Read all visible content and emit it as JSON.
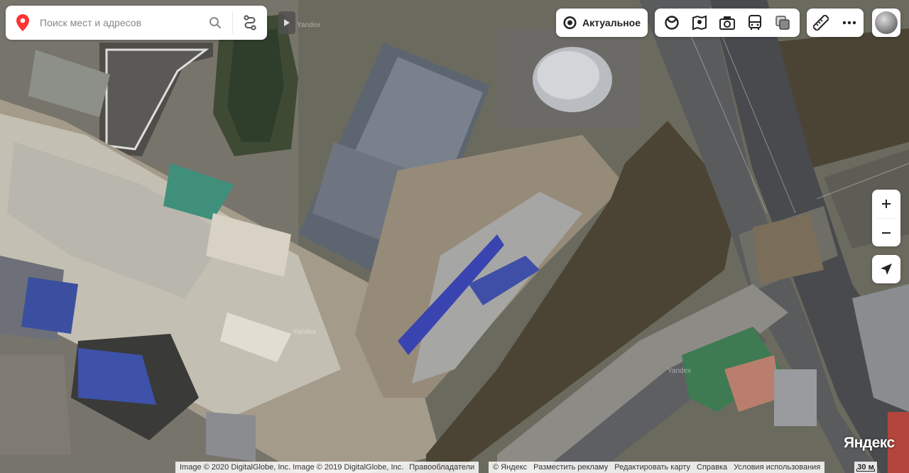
{
  "search": {
    "placeholder": "Поиск мест и адресов"
  },
  "layer_button": {
    "label": "Актуальное"
  },
  "watermarks": [
    "Yandex",
    "Yandex",
    "Yandex"
  ],
  "brand": "Яндекс",
  "attribution_left": {
    "text": "Image © 2020 DigitalGlobe, Inc. Image © 2019 DigitalGlobe, Inc.",
    "link": "Правообладатели"
  },
  "footer_links": [
    "© Яндекс",
    "Разместить рекламу",
    "Редактировать карту",
    "Справка",
    "Условия использования"
  ],
  "scale": "30 м",
  "colors": {
    "pin": "#f33",
    "panel": "#ffffff",
    "river": "#4b4434"
  },
  "icons": {
    "search": "search-icon",
    "route": "route-icon",
    "layers": [
      "panorama-icon",
      "traffic-icon",
      "photo-icon",
      "transit-icon",
      "map-layers-icon"
    ],
    "ruler": "ruler-icon",
    "more": "more-icon",
    "zoom_in": "plus-icon",
    "zoom_out": "minus-icon",
    "locate": "locate-icon"
  }
}
